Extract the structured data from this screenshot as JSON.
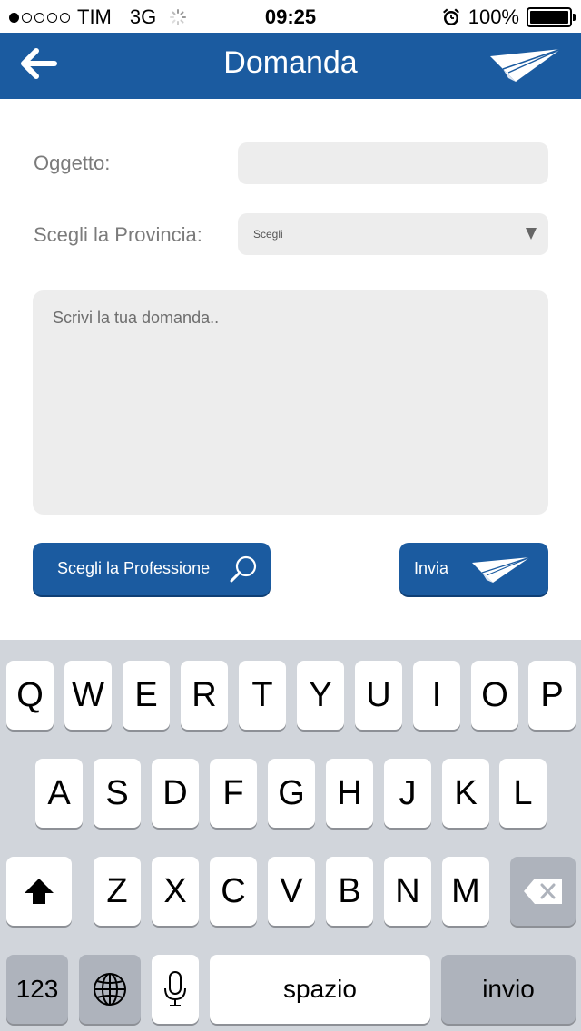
{
  "status_bar": {
    "signal_dots": [
      true,
      false,
      false,
      false,
      false
    ],
    "carrier": "TIM",
    "network": "3G",
    "time": "09:25",
    "alarm_icon": "alarm-clock-icon",
    "battery_percent": "100%",
    "battery_level": 1.0
  },
  "nav": {
    "title": "Domanda",
    "back_icon": "arrow-left-icon",
    "send_icon": "paper-plane-icon"
  },
  "form": {
    "subject_label": "Oggetto:",
    "subject_value": "",
    "province_label": "Scegli la Provincia:",
    "province_selected": "Scegli",
    "question_placeholder": "Scrivi la tua domanda..",
    "question_value": "",
    "profession_button": "Scegli la Professione",
    "send_button": "Invia"
  },
  "colors": {
    "brand_blue": "#1b5ba0",
    "field_gray": "#ededed",
    "keyboard_bg": "#d1d5db"
  },
  "keyboard": {
    "row1": [
      "Q",
      "W",
      "E",
      "R",
      "T",
      "Y",
      "U",
      "I",
      "O",
      "P"
    ],
    "row2": [
      "A",
      "S",
      "D",
      "F",
      "G",
      "H",
      "J",
      "K",
      "L"
    ],
    "row3": [
      "Z",
      "X",
      "C",
      "V",
      "B",
      "N",
      "M"
    ],
    "numbers_key": "123",
    "space_key": "spazio",
    "return_key": "invio",
    "shift_icon": "shift-arrow-icon",
    "backspace_icon": "backspace-icon",
    "globe_icon": "globe-icon",
    "mic_icon": "microphone-icon"
  }
}
